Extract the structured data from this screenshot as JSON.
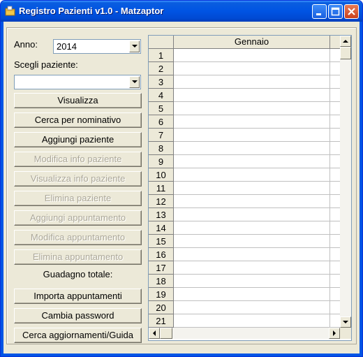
{
  "window": {
    "title": "Registro Pazienti v1.0 - Matzaptor"
  },
  "form": {
    "anno_label": "Anno:",
    "anno_value": "2014",
    "paziente_label": "Scegli paziente:",
    "paziente_value": "",
    "guadagno_label": "Guadagno totale:"
  },
  "buttons": {
    "visualizza": "Visualizza",
    "cerca_nominativo": "Cerca per nominativo",
    "aggiungi_paziente": "Aggiungi paziente",
    "modifica_info": "Modifica info paziente",
    "visualizza_info": "Visualizza info paziente",
    "elimina_paziente": "Elimina paziente",
    "aggiungi_appuntamento": "Aggiungi appuntamento",
    "modifica_appuntamento": "Modifica appuntamento",
    "elimina_appuntamento": "Elimina appuntamento",
    "importa_appuntamenti": "Importa appuntamenti",
    "cambia_password": "Cambia password",
    "cerca_aggiornamenti": "Cerca aggiornamenti/Guida"
  },
  "grid": {
    "column_header": "Gennaio",
    "rows": [
      "1",
      "2",
      "3",
      "4",
      "5",
      "6",
      "7",
      "8",
      "9",
      "10",
      "11",
      "12",
      "13",
      "14",
      "15",
      "16",
      "17",
      "18",
      "19",
      "20",
      "21"
    ]
  }
}
